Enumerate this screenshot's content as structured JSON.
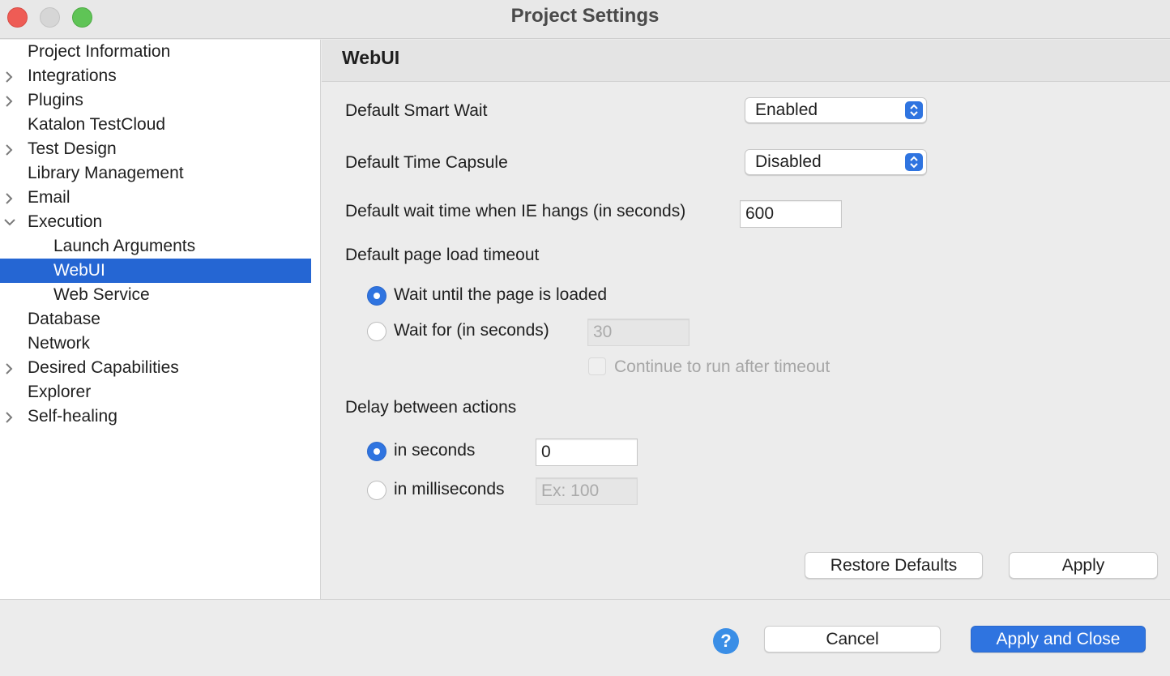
{
  "window": {
    "title": "Project Settings"
  },
  "sidebar": {
    "items": [
      {
        "label": "Project Information",
        "expandable": false,
        "level": 0
      },
      {
        "label": "Integrations",
        "expandable": true,
        "level": 0
      },
      {
        "label": "Plugins",
        "expandable": true,
        "level": 0
      },
      {
        "label": "Katalon TestCloud",
        "expandable": false,
        "level": 0
      },
      {
        "label": "Test Design",
        "expandable": true,
        "level": 0
      },
      {
        "label": "Library Management",
        "expandable": false,
        "level": 0
      },
      {
        "label": "Email",
        "expandable": true,
        "level": 0
      },
      {
        "label": "Execution",
        "expandable": true,
        "expanded": true,
        "level": 0
      },
      {
        "label": "Launch Arguments",
        "expandable": false,
        "level": 1
      },
      {
        "label": "WebUI",
        "expandable": false,
        "level": 1,
        "selected": true
      },
      {
        "label": "Web Service",
        "expandable": false,
        "level": 1
      },
      {
        "label": "Database",
        "expandable": false,
        "level": 0
      },
      {
        "label": "Network",
        "expandable": false,
        "level": 0
      },
      {
        "label": "Desired Capabilities",
        "expandable": true,
        "level": 0
      },
      {
        "label": "Explorer",
        "expandable": false,
        "level": 0
      },
      {
        "label": "Self-healing",
        "expandable": true,
        "level": 0
      }
    ]
  },
  "panel": {
    "title": "WebUI",
    "smart_wait": {
      "label": "Default Smart Wait",
      "value": "Enabled"
    },
    "time_capsule": {
      "label": "Default Time Capsule",
      "value": "Disabled"
    },
    "ie_wait": {
      "label": "Default wait time when IE hangs (in seconds)",
      "value": "600"
    },
    "page_load": {
      "label": "Default page load timeout",
      "option_loaded": "Wait until the page is loaded",
      "option_wait_for": "Wait for (in seconds)",
      "wait_for_value": "30",
      "continue_label": "Continue to run after timeout",
      "selected": "loaded"
    },
    "delay": {
      "label": "Delay between actions",
      "option_seconds": "in seconds",
      "seconds_value": "0",
      "option_ms": "in milliseconds",
      "ms_placeholder": "Ex: 100",
      "selected": "seconds"
    },
    "restore_label": "Restore Defaults",
    "apply_label": "Apply"
  },
  "footer": {
    "help_glyph": "?",
    "cancel_label": "Cancel",
    "apply_close_label": "Apply and Close"
  },
  "colors": {
    "accent": "#2f74e0",
    "selection": "#2566d3"
  }
}
